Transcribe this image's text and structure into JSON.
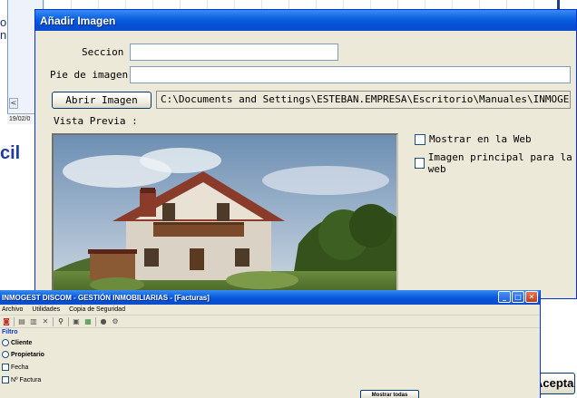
{
  "background": {
    "left_letters": [
      "o",
      "n"
    ],
    "scroll_left": "<",
    "date_fragment": "19/02/0",
    "cil_fragment": "cil"
  },
  "dialog": {
    "title": "Añadir Imagen",
    "seccion_label": "Seccion",
    "seccion_value": "",
    "pie_label": "Pie de imagen",
    "pie_value": "",
    "abrir_button": "Abrir Imagen",
    "path_value": "C:\\Documents and Settings\\ESTEBAN.EMPRESA\\Escritorio\\Manuales\\INMOGEST\\im",
    "vista_previa": "Vista Previa :",
    "mostrar_web": "Mostrar en la Web",
    "imagen_principal": "Imagen principal para la web"
  },
  "aceptar_label": "Aceptar",
  "app": {
    "title": "INMOGEST DISCOM - GESTIÓN INMOBILIARIAS - [Facturas]",
    "menu": [
      "Archivo",
      "Utilidades",
      "Copia de Seguridad"
    ],
    "filter_title": "Filtro",
    "options": [
      {
        "type": "radio",
        "label": "Cliente"
      },
      {
        "type": "radio",
        "label": "Propietario"
      },
      {
        "type": "check",
        "label": "Fecha"
      },
      {
        "type": "check",
        "label": "Nº Factura"
      }
    ],
    "mostrar_todas": "Mostrar todas"
  },
  "colors": {
    "xp_title_blue": "#0a5fe0",
    "dialog_bg": "#ece9d8",
    "filter_blue": "#0a3ad8",
    "cil_blue": "#1f3aa3"
  }
}
